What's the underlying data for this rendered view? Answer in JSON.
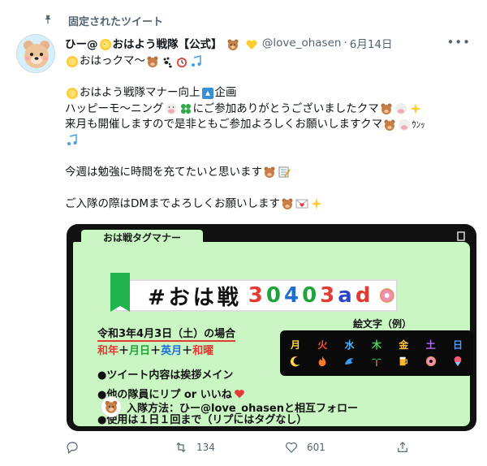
{
  "pinned": {
    "label": "固定されたツイート"
  },
  "tweet": {
    "name_prefix": "ひー@",
    "name_main": "おはよう戦隊【公式】",
    "handle": "@love_ohasen",
    "date": "6月14日",
    "more": "•••",
    "lines": {
      "l1": "おはっクマ～",
      "l3a": "おはよう戦隊マナー向上",
      "l3b": "企画",
      "l4a": "ハッピーモ～ニング",
      "l4b": "にご参加ありがとうございましたクマ",
      "l5a": "来月も開催しますので是非ともご参加よろしくお願いしますクマ",
      "l5b": "ｳﾝｯ",
      "l8": "今週は勉強に時間を充てたいと思います",
      "l10": "ご入隊の際はDMまでよろしくお願いします"
    }
  },
  "card": {
    "tab": "おは戦タグマナー",
    "title_prefix": "#おは戦",
    "title_chars": [
      "3",
      "0",
      "4",
      "0",
      "3",
      "a",
      "d"
    ],
    "title_colors": [
      "#e53935",
      "#1fa33a",
      "#1e6fd0",
      "#1fa33a",
      "#e53935",
      "#2a48c8",
      "#e53935"
    ],
    "date_line": "令和3年4月3日（土）の場合",
    "days": [
      {
        "text": "和年",
        "color": "#e53935"
      },
      {
        "text": "＋",
        "color": "#111"
      },
      {
        "text": "月日",
        "color": "#1fa33a"
      },
      {
        "text": "＋",
        "color": "#111"
      },
      {
        "text": "英月",
        "color": "#1e6fd0"
      },
      {
        "text": "＋",
        "color": "#111"
      },
      {
        "text": "和曜",
        "color": "#e53935"
      }
    ],
    "bullet1": "●ツイート内容は挨拶メイン",
    "bullet2": "●他の隊員にリプ or いいね",
    "bullet3": "●使用は１日１回まで（リプにはタグなし）",
    "emoji_caption": "絵文字（例）",
    "weekdays": [
      {
        "label": "月",
        "color": "#ffd54a"
      },
      {
        "label": "火",
        "color": "#ff4b3e"
      },
      {
        "label": "水",
        "color": "#4fb6ff"
      },
      {
        "label": "木",
        "color": "#43d15a"
      },
      {
        "label": "金",
        "color": "#ffc23a"
      },
      {
        "label": "土",
        "color": "#b36bff"
      },
      {
        "label": "日",
        "color": "#4f9bff"
      }
    ],
    "weekday_icons": [
      "crescent-moon-icon",
      "fire-icon",
      "water-wave-icon",
      "palm-tree-icon",
      "beer-icon",
      "donut-icon",
      "shaved-ice-icon"
    ],
    "join": "入隊方法：ひー@love_ohasenと相互フォロー"
  },
  "actions": {
    "reply_count": "",
    "retweet_count": "134",
    "like_count": "601"
  },
  "colors": {
    "secondary_text": "#536471",
    "card_green": "#c9f6c3"
  }
}
